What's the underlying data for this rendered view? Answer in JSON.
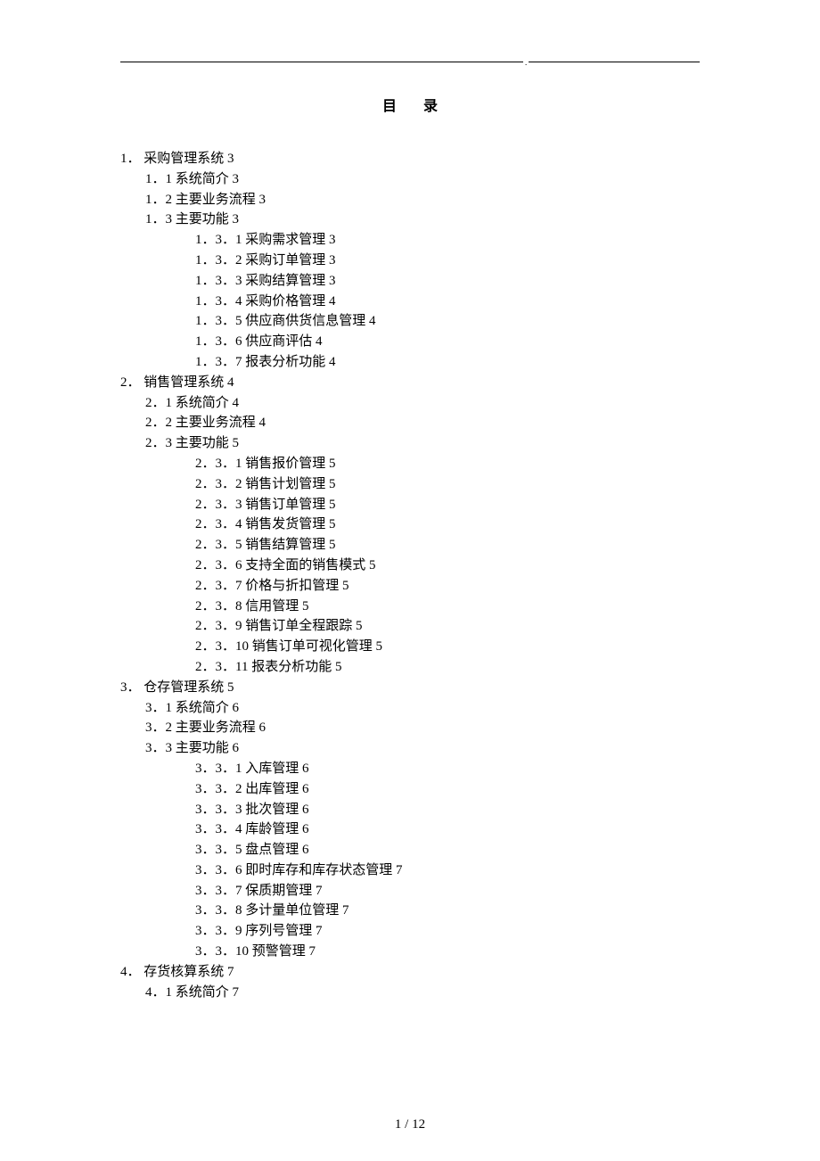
{
  "title": "目录",
  "page_footer": "1 / 12",
  "toc": [
    {
      "level": 1,
      "num": "1．",
      "label": "采购管理系统",
      "page": "3"
    },
    {
      "level": 2,
      "num": "1．1",
      "label": "系统简介",
      "page": "3"
    },
    {
      "level": 2,
      "num": "1．2",
      "label": "主要业务流程",
      "page": "3"
    },
    {
      "level": 2,
      "num": "1．3",
      "label": "主要功能",
      "page": "3"
    },
    {
      "level": 3,
      "num": "1．3．1",
      "label": "采购需求管理",
      "page": "3"
    },
    {
      "level": 3,
      "num": "1．3．2",
      "label": "采购订单管理",
      "page": "3"
    },
    {
      "level": 3,
      "num": "1．3．3",
      "label": "采购结算管理",
      "page": "3"
    },
    {
      "level": 3,
      "num": "1．3．4",
      "label": "采购价格管理",
      "page": "4"
    },
    {
      "level": 3,
      "num": "1．3．5",
      "label": "供应商供货信息管理",
      "page": "4"
    },
    {
      "level": 3,
      "num": "1．3．6",
      "label": "供应商评估",
      "page": "4"
    },
    {
      "level": 3,
      "num": "1．3．7",
      "label": "报表分析功能",
      "page": "4"
    },
    {
      "level": 1,
      "num": "2．",
      "label": "销售管理系统",
      "page": "4"
    },
    {
      "level": 2,
      "num": "2．1",
      "label": "系统简介",
      "page": "4"
    },
    {
      "level": 2,
      "num": "2．2",
      "label": "主要业务流程",
      "page": "4"
    },
    {
      "level": 2,
      "num": "2．3",
      "label": "主要功能",
      "page": "5"
    },
    {
      "level": 3,
      "num": "2．3．1",
      "label": "销售报价管理",
      "page": "5"
    },
    {
      "level": 3,
      "num": "2．3．2",
      "label": "销售计划管理",
      "page": "5"
    },
    {
      "level": 3,
      "num": "2．3．3",
      "label": "销售订单管理",
      "page": "5"
    },
    {
      "level": 3,
      "num": "2．3．4",
      "label": "销售发货管理",
      "page": "5"
    },
    {
      "level": 3,
      "num": "2．3．5",
      "label": "销售结算管理",
      "page": "5"
    },
    {
      "level": 3,
      "num": "2．3．6",
      "label": "支持全面的销售模式",
      "page": "5"
    },
    {
      "level": 3,
      "num": "2．3．7",
      "label": "价格与折扣管理",
      "page": "5"
    },
    {
      "level": 3,
      "num": "2．3．8",
      "label": "信用管理",
      "page": "5"
    },
    {
      "level": 3,
      "num": "2．3．9",
      "label": "销售订单全程跟踪",
      "page": "5"
    },
    {
      "level": 3,
      "num": "2．3．10",
      "label": "销售订单可视化管理",
      "page": "5"
    },
    {
      "level": 3,
      "num": "2．3．11",
      "label": "报表分析功能",
      "page": "5"
    },
    {
      "level": 1,
      "num": "3．",
      "label": "仓存管理系统",
      "page": "5"
    },
    {
      "level": 2,
      "num": "3．1",
      "label": "系统简介",
      "page": "6"
    },
    {
      "level": 2,
      "num": "3．2",
      "label": "主要业务流程",
      "page": "6"
    },
    {
      "level": 2,
      "num": "3．3",
      "label": "主要功能",
      "page": "6"
    },
    {
      "level": 3,
      "num": "3．3．1",
      "label": "入库管理",
      "page": "6"
    },
    {
      "level": 3,
      "num": "3．3．2",
      "label": "出库管理",
      "page": "6"
    },
    {
      "level": 3,
      "num": "3．3．3",
      "label": "批次管理",
      "page": "6"
    },
    {
      "level": 3,
      "num": "3．3．4",
      "label": "库龄管理",
      "page": "6"
    },
    {
      "level": 3,
      "num": "3．3．5",
      "label": "盘点管理",
      "page": "6"
    },
    {
      "level": 3,
      "num": "3．3．6",
      "label": "即时库存和库存状态管理",
      "page": "7"
    },
    {
      "level": 3,
      "num": "3．3．7",
      "label": "保质期管理",
      "page": "7"
    },
    {
      "level": 3,
      "num": "3．3．8",
      "label": "多计量单位管理",
      "page": "7"
    },
    {
      "level": 3,
      "num": "3．3．9",
      "label": "序列号管理",
      "page": "7"
    },
    {
      "level": 3,
      "num": "3．3．10",
      "label": "预警管理",
      "page": "7"
    },
    {
      "level": 1,
      "num": "4．",
      "label": "存货核算系统",
      "page": "7"
    },
    {
      "level": 2,
      "num": "4．1",
      "label": "系统简介",
      "page": "7"
    }
  ]
}
